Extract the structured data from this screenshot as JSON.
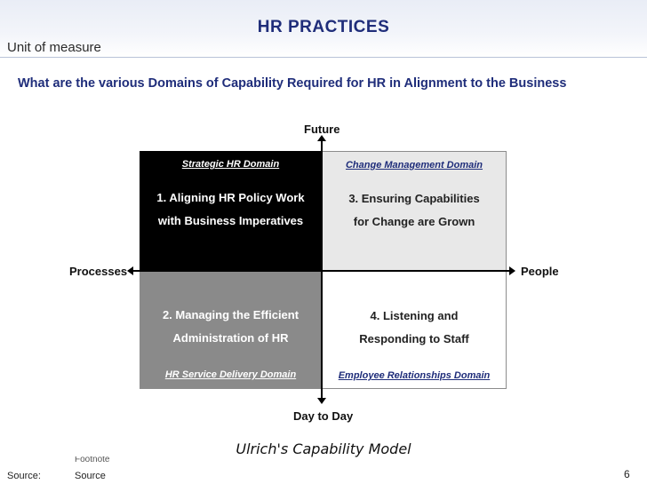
{
  "header": {
    "title": "HR PRACTICES",
    "unit_of_measure": "Unit of measure"
  },
  "question": "What are the various Domains of Capability Required for HR in Alignment to the Business",
  "model": {
    "axes": {
      "top": "Future",
      "bottom": "Day to Day",
      "left": "Processes",
      "right": "People"
    },
    "quadrants": [
      {
        "domain": "Strategic HR Domain",
        "line1": "1. Aligning HR Policy Work",
        "line2": "with Business Imperatives"
      },
      {
        "domain": "Change Management Domain",
        "line1": "3. Ensuring Capabilities",
        "line2": "for Change are Grown"
      },
      {
        "domain": "HR Service Delivery Domain",
        "line1": "2. Managing the Efficient",
        "line2": "Administration of HR"
      },
      {
        "domain": "Employee Relationships Domain",
        "line1": "4. Listening and",
        "line2": "Responding to Staff"
      }
    ],
    "caption": "Ulrich's Capability Model"
  },
  "footer": {
    "footnote": "Footnote",
    "source_label": "Source:",
    "source_text": "Source",
    "page_number": "6"
  },
  "colors": {
    "title": "#1f2d7a",
    "strategic_quadrant": "#000000",
    "service_quadrant": "#8a8a8a",
    "change_quadrant": "#e8e8e8",
    "employee_quadrant": "#ffffff"
  }
}
